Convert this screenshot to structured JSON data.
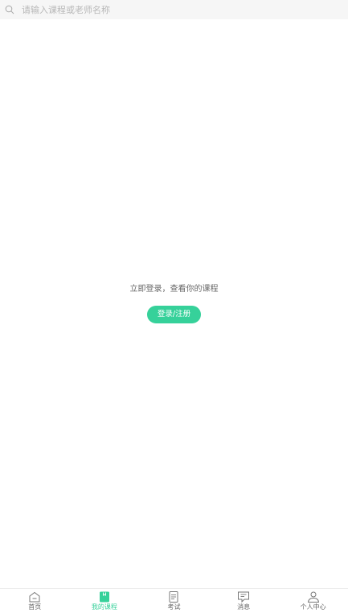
{
  "search": {
    "placeholder": "请输入课程或老师名称"
  },
  "main": {
    "prompt": "立即登录，查看你的课程",
    "login_button": "登录/注册"
  },
  "tabbar": {
    "items": [
      {
        "label": "首页",
        "icon": "home-icon"
      },
      {
        "label": "我的课程",
        "icon": "my-courses-icon",
        "active": true
      },
      {
        "label": "考试",
        "icon": "exam-icon"
      },
      {
        "label": "消息",
        "icon": "message-icon"
      },
      {
        "label": "个人中心",
        "icon": "profile-icon"
      }
    ]
  },
  "colors": {
    "accent": "#36d19a",
    "search_bg": "#f6f6f6",
    "placeholder": "#b8b8b8",
    "inactive_text": "#666666"
  }
}
